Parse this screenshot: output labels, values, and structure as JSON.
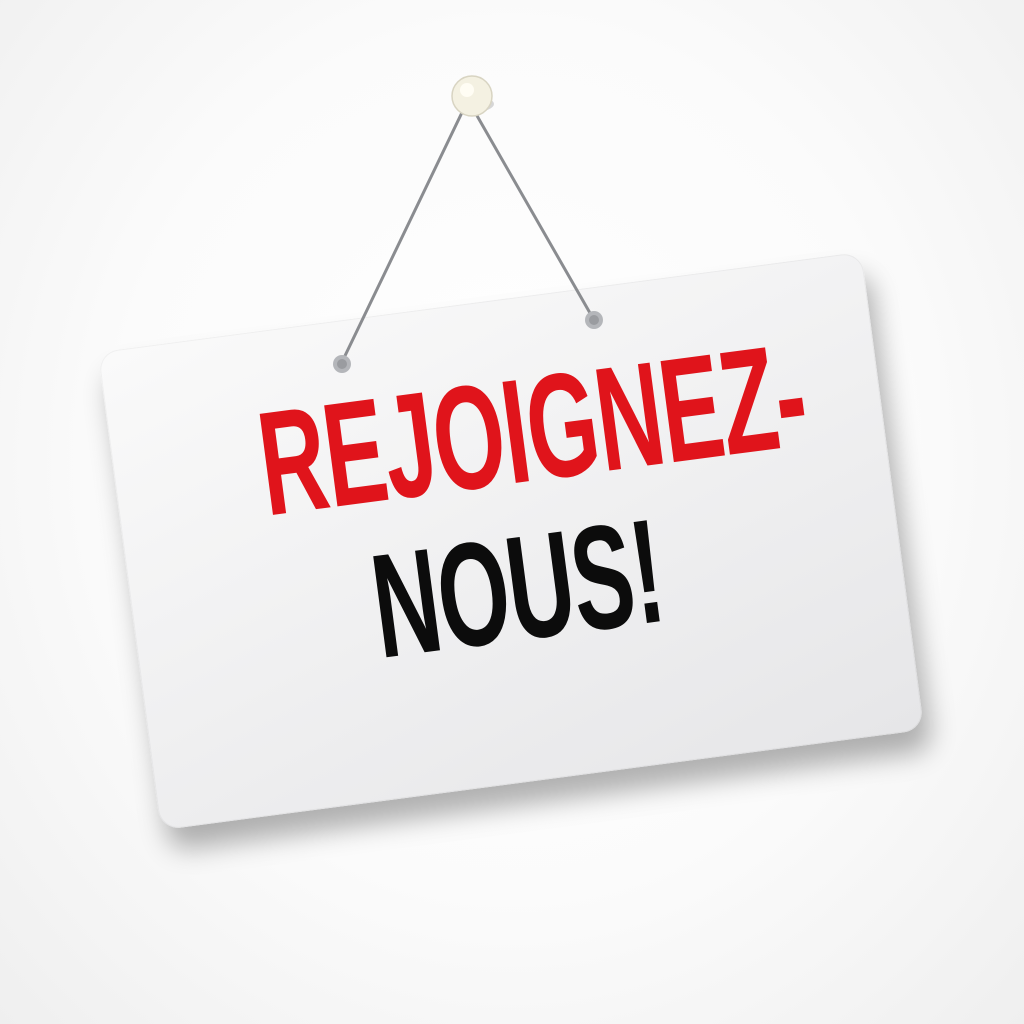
{
  "sign": {
    "line1": "REJOIGNEZ-",
    "line2": "NOUS!"
  },
  "colors": {
    "line1": "#e0141b",
    "line2": "#0c0c0c",
    "sign_face": "#f2f2f3",
    "string": "#8a8c90",
    "pin": "#f4f1e2"
  },
  "icons": {
    "pin": "push-pin-icon",
    "grommet": "eyelet-icon"
  }
}
